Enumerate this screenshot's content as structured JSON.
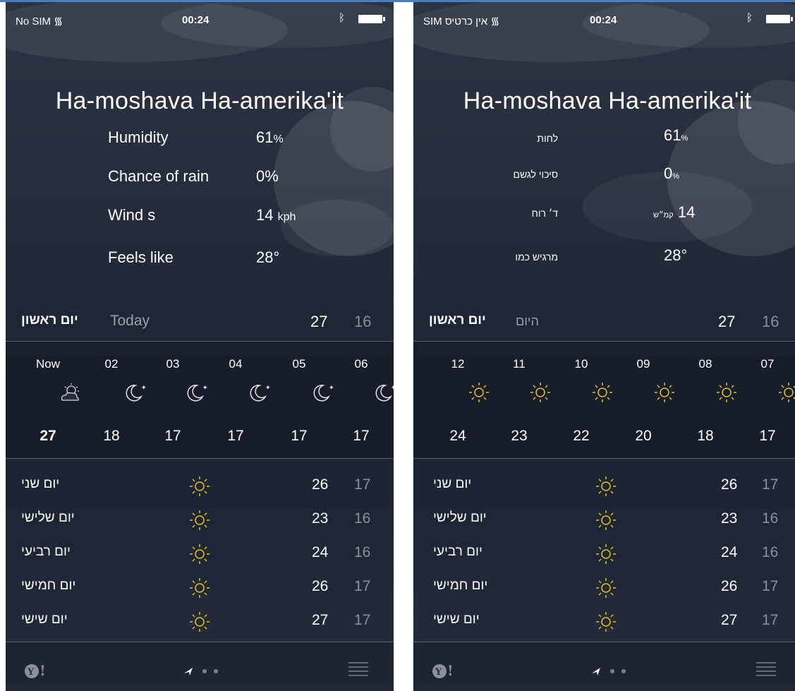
{
  "left": {
    "status": {
      "carrier": "No SIM",
      "time": "00:24"
    },
    "city": "Ha-moshava Ha-amerika'it",
    "details": [
      {
        "label": "Humidity",
        "value": "61",
        "unit": "%"
      },
      {
        "label": "Chance of rain",
        "value": "0%",
        "unit": ""
      },
      {
        "label": "Wind s",
        "value": "14",
        "unit": "kph"
      },
      {
        "label": "Feels like",
        "value": "28°",
        "unit": ""
      }
    ],
    "today": {
      "day": "יום ראשון",
      "word": "Today",
      "hi": "27",
      "lo": "16"
    },
    "hourly": [
      {
        "time": "Now",
        "icon": "partly-cloudy-icon",
        "temp": "27"
      },
      {
        "time": "02",
        "icon": "moon-icon",
        "temp": "18"
      },
      {
        "time": "03",
        "icon": "moon-icon",
        "temp": "17"
      },
      {
        "time": "04",
        "icon": "moon-icon",
        "temp": "17"
      },
      {
        "time": "05",
        "icon": "moon-icon",
        "temp": "17"
      },
      {
        "time": "06",
        "icon": "moon-icon",
        "temp": "17"
      }
    ],
    "daily": [
      {
        "day": "יום שני",
        "icon": "sun-icon",
        "hi": "26",
        "lo": "17"
      },
      {
        "day": "יום שלישי",
        "icon": "sun-icon",
        "hi": "23",
        "lo": "16"
      },
      {
        "day": "יום רביעי",
        "icon": "sun-icon",
        "hi": "24",
        "lo": "16"
      },
      {
        "day": "יום חמישי",
        "icon": "sun-icon",
        "hi": "26",
        "lo": "17"
      },
      {
        "day": "יום שישי",
        "icon": "sun-icon",
        "hi": "27",
        "lo": "17"
      }
    ]
  },
  "right": {
    "status": {
      "carrier": "אין כרטיס SIM",
      "time": "00:24"
    },
    "city": "Ha-moshava Ha-amerika'it",
    "details": [
      {
        "label": "לחות",
        "value": "61",
        "unit": "%"
      },
      {
        "label": "סיכוי לגשם",
        "value": "0",
        "unit": "%"
      },
      {
        "label": "ד׳ רוח",
        "value": "14",
        "unit": "קמ״ש"
      },
      {
        "label": "מרגיש כמו",
        "value": "28°",
        "unit": ""
      }
    ],
    "today": {
      "day": "יום ראשון",
      "word": "היום",
      "hi": "27",
      "lo": "16"
    },
    "hourly": [
      {
        "time": "12",
        "icon": "sun-icon",
        "temp": "24"
      },
      {
        "time": "11",
        "icon": "sun-icon",
        "temp": "23"
      },
      {
        "time": "10",
        "icon": "sun-icon",
        "temp": "22"
      },
      {
        "time": "09",
        "icon": "sun-icon",
        "temp": "20"
      },
      {
        "time": "08",
        "icon": "sun-icon",
        "temp": "18"
      },
      {
        "time": "07",
        "icon": "sun-icon",
        "temp": "17"
      }
    ],
    "daily": [
      {
        "day": "יום שני",
        "icon": "sun-icon",
        "hi": "26",
        "lo": "17"
      },
      {
        "day": "יום שלישי",
        "icon": "sun-icon",
        "hi": "23",
        "lo": "16"
      },
      {
        "day": "יום רביעי",
        "icon": "sun-icon",
        "hi": "24",
        "lo": "16"
      },
      {
        "day": "יום חמישי",
        "icon": "sun-icon",
        "hi": "26",
        "lo": "17"
      },
      {
        "day": "יום שישי",
        "icon": "sun-icon",
        "hi": "27",
        "lo": "17"
      }
    ]
  },
  "colors": {
    "sun": "#e8c21a",
    "accent_blue": "#4a7fc0"
  }
}
